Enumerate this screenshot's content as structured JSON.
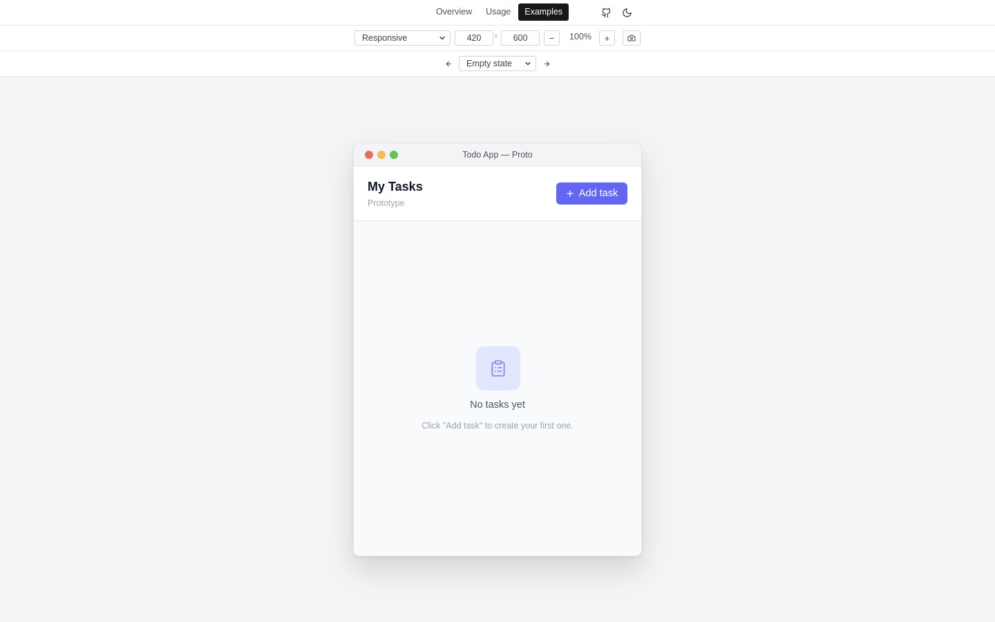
{
  "nav": {
    "items": [
      {
        "label": "Overview",
        "active": false
      },
      {
        "label": "Usage",
        "active": false
      },
      {
        "label": "Examples",
        "active": true
      }
    ],
    "icons": [
      "github-icon",
      "moon-icon"
    ]
  },
  "toolbar": {
    "device_select": "Responsive",
    "width": "420",
    "height": "600",
    "times_symbol": "×",
    "zoom_out": "−",
    "zoom": "100%",
    "zoom_in": "+",
    "screenshot_icon": "camera-icon"
  },
  "state_bar": {
    "prev_icon": "arrow-left-icon",
    "state_select": "Empty state",
    "next_icon": "arrow-right-icon"
  },
  "window": {
    "title": "Todo App — Proto",
    "header": {
      "title": "My Tasks",
      "subtitle": "Prototype",
      "add_button": "Add task"
    },
    "empty_state": {
      "icon": "clipboard-list-icon",
      "title": "No tasks yet",
      "hint": "Click \"Add task\" to create your first one."
    }
  },
  "colors": {
    "accent": "#6366f1",
    "nav_active_bg": "#18181b",
    "canvas_bg": "#f4f4f4",
    "traffic_red": "#ee6a5f",
    "traffic_yellow": "#f5bf4f",
    "traffic_green": "#61c454"
  }
}
